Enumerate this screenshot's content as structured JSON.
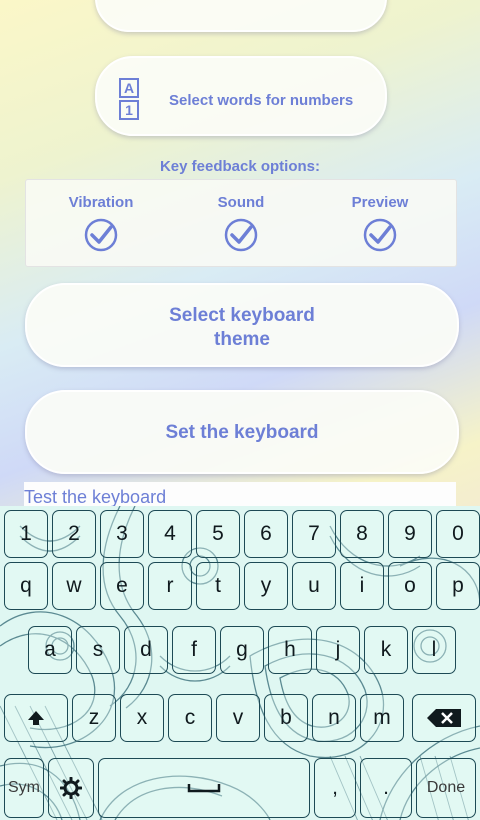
{
  "settings": {
    "numbers_label": "Select words for numbers",
    "numbers_icon_top": "A",
    "numbers_icon_bottom": "1",
    "feedback_title": "Key feedback options:",
    "feedback_options": [
      {
        "label": "Vibration",
        "checked": true
      },
      {
        "label": "Sound",
        "checked": true
      },
      {
        "label": "Preview",
        "checked": true
      }
    ],
    "theme_line1": "Select keyboard",
    "theme_line2": "theme",
    "set_keyboard_label": "Set the keyboard",
    "test_input_value": "Test the keyboard"
  },
  "keyboard": {
    "row1": [
      "1",
      "2",
      "3",
      "4",
      "5",
      "6",
      "7",
      "8",
      "9",
      "0"
    ],
    "row2": [
      "q",
      "w",
      "e",
      "r",
      "t",
      "y",
      "u",
      "i",
      "o",
      "p"
    ],
    "row3": [
      "a",
      "s",
      "d",
      "f",
      "g",
      "h",
      "j",
      "k",
      "l"
    ],
    "row4": [
      "z",
      "x",
      "c",
      "v",
      "b",
      "n",
      "m"
    ],
    "sym_label": "Sym",
    "comma_label": ",",
    "period_label": ".",
    "done_label": "Done",
    "shift_icon": "shift-icon",
    "backspace_icon": "backspace-icon",
    "settings_icon": "gear-icon",
    "space_icon": "space-icon"
  },
  "colors": {
    "accent": "#6d7fd6",
    "key_border": "#1d4a55",
    "keyboard_bg": "#dff7f2"
  }
}
